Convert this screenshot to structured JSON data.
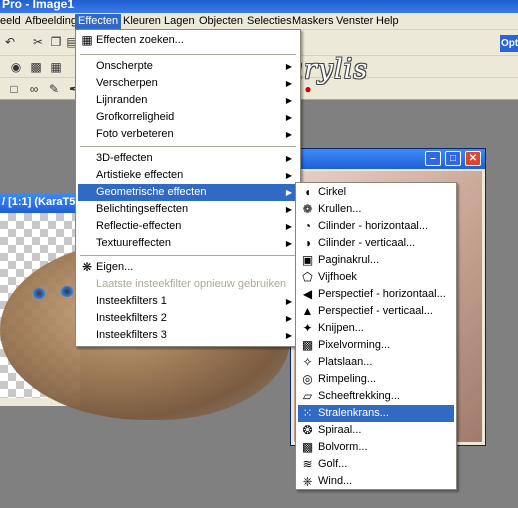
{
  "window": {
    "title": "Pro - Image1"
  },
  "menubar": {
    "items": [
      "eeld",
      "Afbeelding",
      "Effecten",
      "Kleuren",
      "Lagen",
      "Objecten",
      "Selecties",
      "Maskers",
      "Venster",
      "Help"
    ]
  },
  "toolbar": {
    "opt_label": "Opti"
  },
  "image_window": {
    "title": "/ [1:1] (KaraT5"
  },
  "watermark": "cre@nnarylis",
  "effects_menu": {
    "items": [
      {
        "label": "Effecten zoeken...",
        "icon": "effects-browser-icon"
      },
      {
        "label": "Onscherpte",
        "submenu": true
      },
      {
        "label": "Verscherpen",
        "submenu": true
      },
      {
        "label": "Lijnranden",
        "submenu": true
      },
      {
        "label": "Grofkorreligheid",
        "submenu": true
      },
      {
        "label": "Foto verbeteren",
        "submenu": true
      },
      {
        "label": "3D-effecten",
        "submenu": true
      },
      {
        "label": "Artistieke effecten",
        "submenu": true
      },
      {
        "label": "Geometrische effecten",
        "submenu": true,
        "highlighted": true
      },
      {
        "label": "Belichtingseffecten",
        "submenu": true
      },
      {
        "label": "Reflectie-effecten",
        "submenu": true
      },
      {
        "label": "Textuureffecten",
        "submenu": true
      },
      {
        "label": "Eigen...",
        "icon": "user-defined-filter-icon"
      },
      {
        "label": "Laatste insteekfilter opnieuw gebruiken",
        "disabled": true
      },
      {
        "label": "Insteekfilters 1",
        "submenu": true
      },
      {
        "label": "Insteekfilters 2",
        "submenu": true
      },
      {
        "label": "Insteekfilters 3",
        "submenu": true
      }
    ]
  },
  "geometric_menu": {
    "items": [
      {
        "label": "Cirkel",
        "icon": "circle-effect-icon"
      },
      {
        "label": "Krullen...",
        "icon": "curlicues-icon"
      },
      {
        "label": "Cilinder - horizontaal...",
        "icon": "cylinder-horizontal-icon"
      },
      {
        "label": "Cilinder - verticaal...",
        "icon": "cylinder-vertical-icon"
      },
      {
        "label": "Paginakrul...",
        "icon": "page-curl-icon"
      },
      {
        "label": "Vijfhoek",
        "icon": "pentagon-icon"
      },
      {
        "label": "Perspectief - horizontaal...",
        "icon": "perspective-horizontal-icon"
      },
      {
        "label": "Perspectief - verticaal...",
        "icon": "perspective-vertical-icon"
      },
      {
        "label": "Knijpen...",
        "icon": "pinch-icon"
      },
      {
        "label": "Pixelvorming...",
        "icon": "pixelate-icon"
      },
      {
        "label": "Platslaan...",
        "icon": "punch-icon"
      },
      {
        "label": "Rimpeling...",
        "icon": "ripple-icon"
      },
      {
        "label": "Scheeftrekking...",
        "icon": "skew-icon"
      },
      {
        "label": "Stralenkrans...",
        "icon": "spherize-icon",
        "highlighted": true
      },
      {
        "label": "Spiraal...",
        "icon": "twirl-icon"
      },
      {
        "label": "Bolvorm...",
        "icon": "sphere-icon"
      },
      {
        "label": "Golf...",
        "icon": "wave-icon"
      },
      {
        "label": "Wind...",
        "icon": "wind-icon"
      }
    ]
  }
}
